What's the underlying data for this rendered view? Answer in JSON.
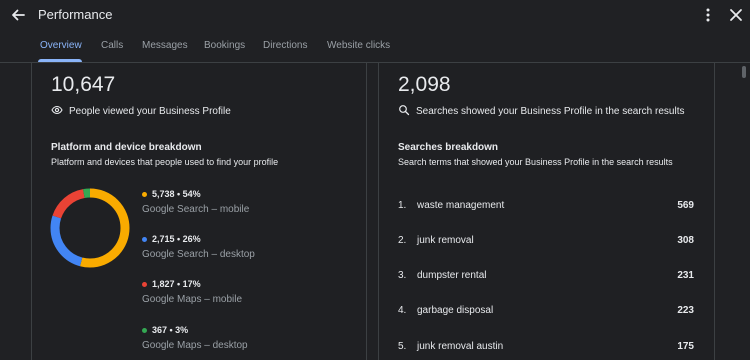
{
  "header": {
    "title": "Performance"
  },
  "tabs": [
    {
      "label": "Overview"
    },
    {
      "label": "Calls"
    },
    {
      "label": "Messages"
    },
    {
      "label": "Bookings"
    },
    {
      "label": "Directions"
    },
    {
      "label": "Website clicks"
    }
  ],
  "views": {
    "total": "10,647",
    "caption": "People viewed your Business Profile",
    "icon": "eye-icon"
  },
  "platform": {
    "title": "Platform and device breakdown",
    "subtitle": "Platform and devices that people used to find your profile",
    "items": [
      {
        "value": "5,738 • 54%",
        "label": "Google Search – mobile",
        "color": "#f9ab00",
        "share": 54
      },
      {
        "value": "2,715 • 26%",
        "label": "Google Search – desktop",
        "color": "#4285f4",
        "share": 26
      },
      {
        "value": "1,827 • 17%",
        "label": "Google Maps – mobile",
        "color": "#ea4335",
        "share": 17
      },
      {
        "value": "367 • 3%",
        "label": "Google Maps – desktop",
        "color": "#34a853",
        "share": 3
      }
    ]
  },
  "searches": {
    "total": "2,098",
    "caption": "Searches showed your Business Profile in the search results",
    "icon": "search-icon"
  },
  "search_breakdown": {
    "title": "Searches breakdown",
    "subtitle": "Search terms that showed your Business Profile in the search results",
    "rows": [
      {
        "rank": "1.",
        "term": "waste management",
        "count": "569"
      },
      {
        "rank": "2.",
        "term": "junk removal",
        "count": "308"
      },
      {
        "rank": "3.",
        "term": "dumpster rental",
        "count": "231"
      },
      {
        "rank": "4.",
        "term": "garbage disposal",
        "count": "223"
      },
      {
        "rank": "5.",
        "term": "junk removal austin",
        "count": "175"
      }
    ]
  },
  "colors": {
    "accent": "#8ab4f8",
    "background": "#202124"
  }
}
